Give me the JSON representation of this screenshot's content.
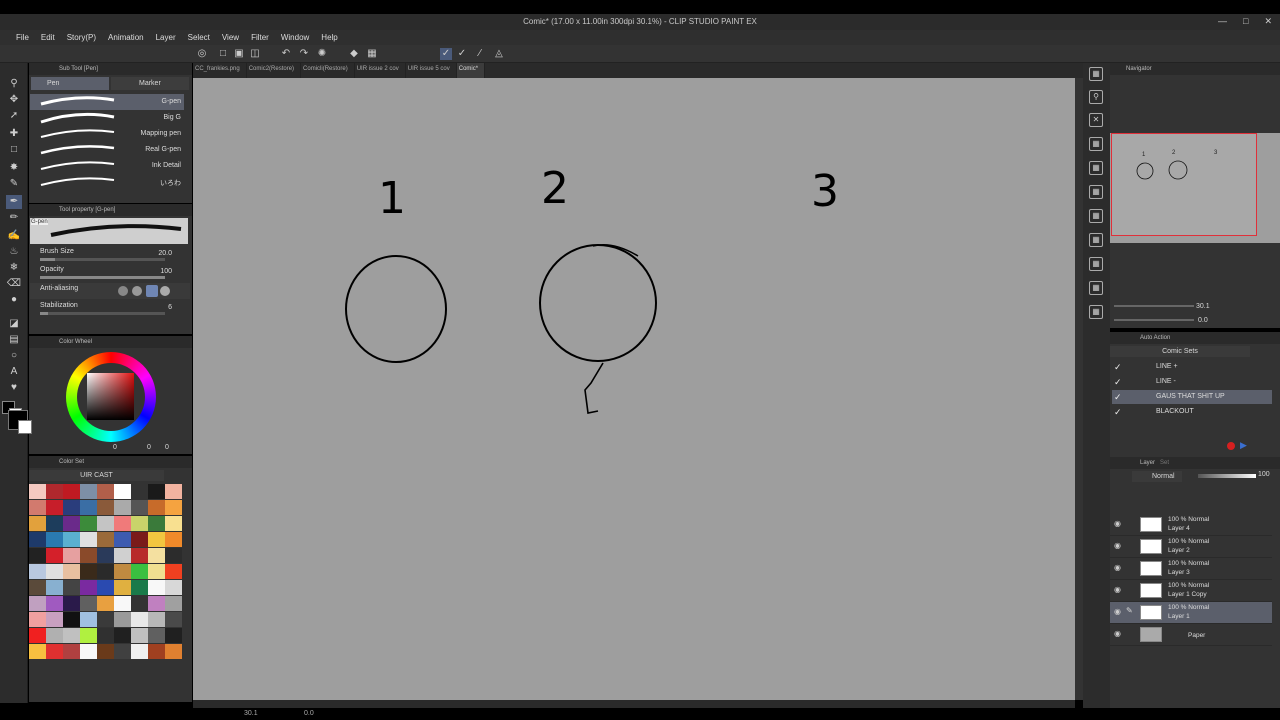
{
  "window": {
    "title": "Comic* (17.00 x 11.00in 300dpi 30.1%) - CLIP STUDIO PAINT EX"
  },
  "menu": [
    "File",
    "Edit",
    "Story(P)",
    "Animation",
    "Layer",
    "Select",
    "View",
    "Filter",
    "Window",
    "Help"
  ],
  "tabs": [
    {
      "label": "CC_frankies.png"
    },
    {
      "label": "Comic2(Restore)"
    },
    {
      "label": "Comicli(Restore)"
    },
    {
      "label": "UIR issue 2 cov"
    },
    {
      "label": "UIR issue 5 cov"
    },
    {
      "label": "Comic*"
    }
  ],
  "subtool": {
    "header": "Sub Tool [Pen]",
    "tabs": [
      "Pen",
      "Marker"
    ],
    "items": [
      "G-pen",
      "Big G",
      "Mapping pen",
      "Real G-pen",
      "Ink Detail",
      "いろわ"
    ]
  },
  "tool_property": {
    "header": "Tool property [G-pen]",
    "preview_label": "G-pen",
    "brush_size_label": "Brush Size",
    "brush_size_value": "20.0",
    "opacity_label": "Opacity",
    "opacity_value": "100",
    "anti_aliasing_label": "Anti-aliasing",
    "stabilization_label": "Stabilization",
    "stabilization_value": "6",
    "brush_size_fraction": 0.12,
    "opacity_fraction": 1.0,
    "stabilization_fraction": 0.06
  },
  "color_wheel": {
    "header": "Color Wheel",
    "values": [
      "0",
      "0",
      "0"
    ]
  },
  "color_set": {
    "header": "Color Set",
    "set_name": "UIR CAST"
  },
  "canvas_numbers": [
    "1",
    "2",
    "3"
  ],
  "navigator": {
    "header": "Navigator",
    "zoom": "30.1",
    "rotation": "0.0"
  },
  "auto_action": {
    "header": "Auto Action",
    "set_name": "Comic Sets",
    "items": [
      "LINE +",
      "LINE -",
      "GAUS THAT SHIT UP",
      "BLACKOUT"
    ],
    "selected": "GAUS THAT SHIT UP"
  },
  "layer_panel": {
    "header": "Layer",
    "tab2": "Set",
    "blend_mode": "Normal",
    "opacity": "100",
    "layers": [
      {
        "mode": "100 % Normal",
        "name": "Layer 4"
      },
      {
        "mode": "100 % Normal",
        "name": "Layer 2"
      },
      {
        "mode": "100 % Normal",
        "name": "Layer 3"
      },
      {
        "mode": "100 % Normal",
        "name": "Layer 1 Copy"
      },
      {
        "mode": "100 % Normal",
        "name": "Layer 1"
      },
      {
        "mode": "",
        "name": "Paper"
      }
    ],
    "selected": "Layer 1"
  },
  "status": {
    "zoom": "30.1",
    "angle": "0.0"
  },
  "colors": {
    "canvas_bg": "#9e9e9e",
    "panel_bg": "#333333",
    "selection": "#5b5f6b",
    "navigator_frame": "#e0303a",
    "record": "#d62020",
    "play": "#3a6fd0"
  }
}
